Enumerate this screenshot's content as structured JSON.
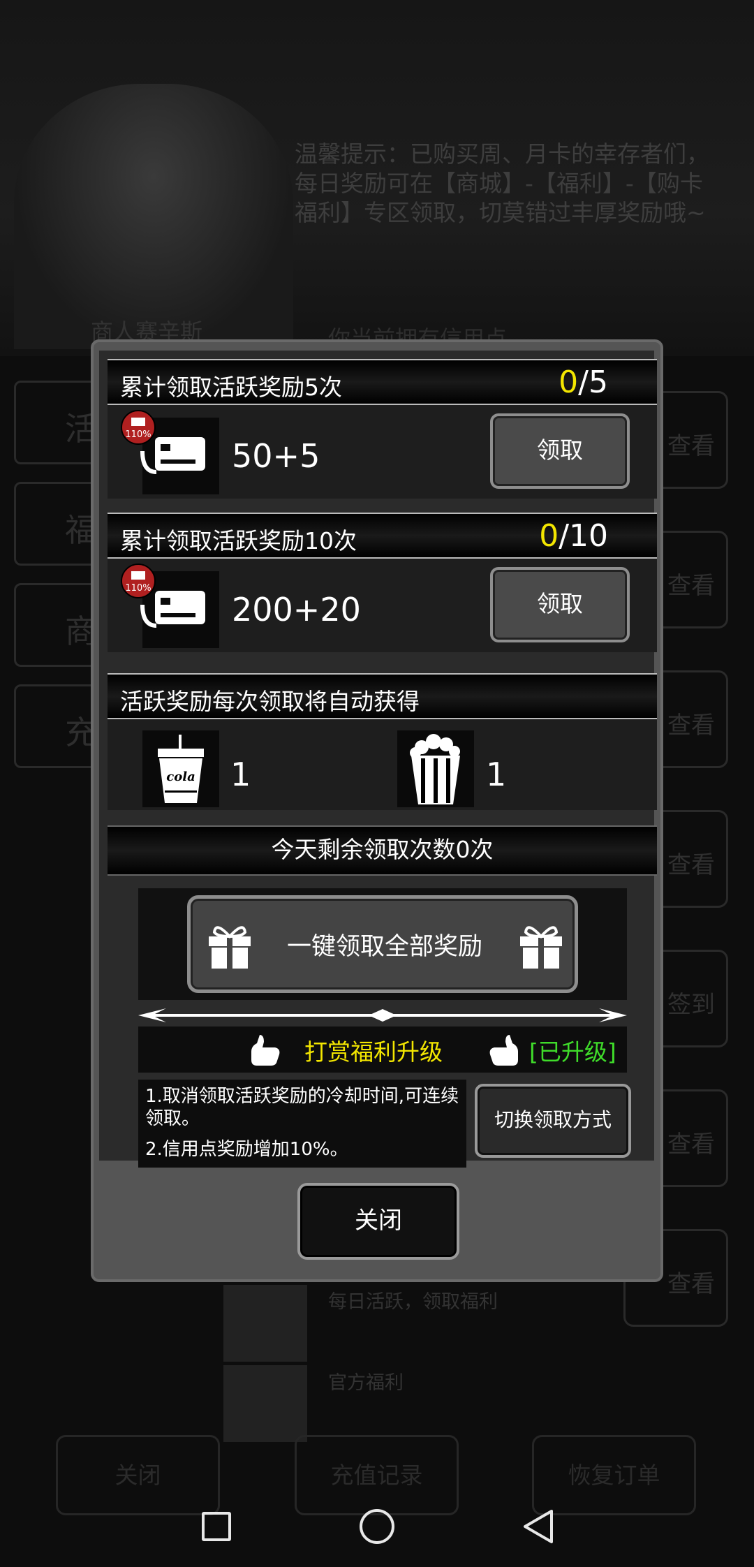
{
  "background": {
    "tip": "温馨提示：已购买周、月卡的幸存者们，每日奖励可在【商城】-【福利】-【购卡福利】专区领取，切莫错过丰厚奖励哦~",
    "merchant_name": "商人赛辛斯",
    "credit_text": "你当前拥有信用点",
    "left_nav": [
      "活",
      "福",
      "商",
      "充"
    ],
    "right_buttons": [
      "查看",
      "查看",
      "查看",
      "查看",
      "签到",
      "查看",
      "查看"
    ],
    "list_items": [
      "每日活跃，领取福利",
      "官方福利"
    ],
    "bottom_buttons": [
      "关闭",
      "充值记录",
      "恢复订单"
    ]
  },
  "modal": {
    "tasks": [
      {
        "title": "累计领取活跃奖励5次",
        "progress_current": "0",
        "progress_total": "/5",
        "badge": "110%",
        "reward": "50+5",
        "claim_label": "领取"
      },
      {
        "title": "累计领取活跃奖励10次",
        "progress_current": "0",
        "progress_total": "/10",
        "badge": "110%",
        "reward": "200+20",
        "claim_label": "领取"
      }
    ],
    "auto_reward": {
      "title": "活跃奖励每次领取将自动获得",
      "items": [
        {
          "icon": "cola-icon",
          "label": "cola",
          "count": "1"
        },
        {
          "icon": "popcorn-icon",
          "count": "1"
        }
      ]
    },
    "remaining_text": "今天剩余领取次数0次",
    "oneclick_label": "一键领取全部奖励",
    "upgrade_title": "打赏福利升级",
    "upgrade_status": "[已升级]",
    "descriptions": [
      "1.取消领取活跃奖励的冷却时间,可连续领取。",
      "2.信用点奖励增加10%。"
    ],
    "switch_label": "切换领取方式",
    "close_label": "关闭"
  },
  "colors": {
    "progress_highlight": "#f3e600",
    "upgrade_title": "#f3e600",
    "upgrade_status": "#3fdc2a"
  }
}
